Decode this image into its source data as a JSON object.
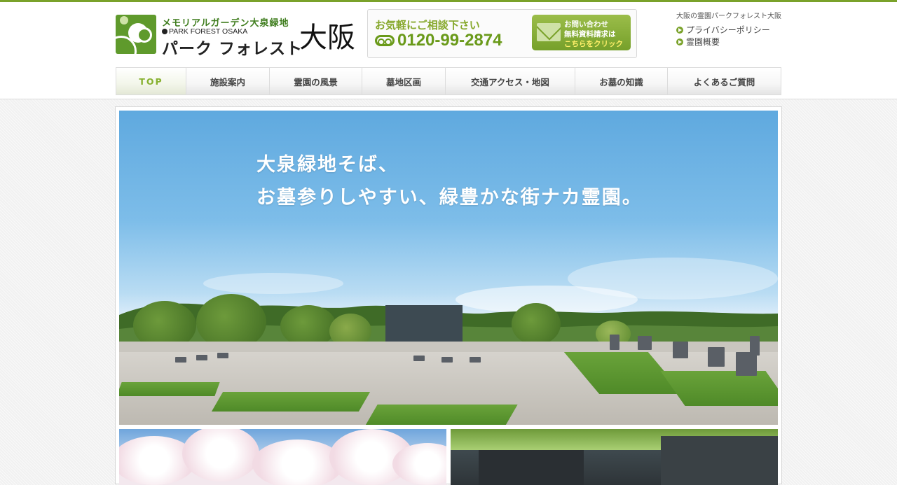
{
  "header": {
    "logo": {
      "subtitle": "メモリアルガーデン大泉緑地",
      "english": "PARK FOREST OSAKA",
      "name": "パーク フォレスト",
      "city": "大阪"
    },
    "contact": {
      "lead": "お気軽にご相談下さい",
      "tel": "0120-99-2874",
      "button_line1": "お問い合わせ",
      "button_line2": "無料資料請求は",
      "button_line3": "こちらをクリック"
    },
    "site_name": "大阪の霊園パークフォレスト大阪",
    "links": [
      {
        "label": "プライバシーポリシー"
      },
      {
        "label": "霊園概要"
      }
    ]
  },
  "nav": {
    "items": [
      {
        "label": "TOP",
        "active": true
      },
      {
        "label": "施設案内",
        "active": false
      },
      {
        "label": "霊園の風景",
        "active": false
      },
      {
        "label": "墓地区画",
        "active": false
      },
      {
        "label": "交通アクセス・地図",
        "active": false
      },
      {
        "label": "お墓の知識",
        "active": false
      },
      {
        "label": "よくあるご質問",
        "active": false
      }
    ]
  },
  "hero": {
    "line1": "大泉緑地そば、",
    "line2": "お墓参りしやすい、緑豊かな街ナカ霊園。"
  },
  "colors": {
    "accent": "#7aa22a",
    "nav_active": "#86b02e",
    "tel": "#6a9a1a"
  }
}
